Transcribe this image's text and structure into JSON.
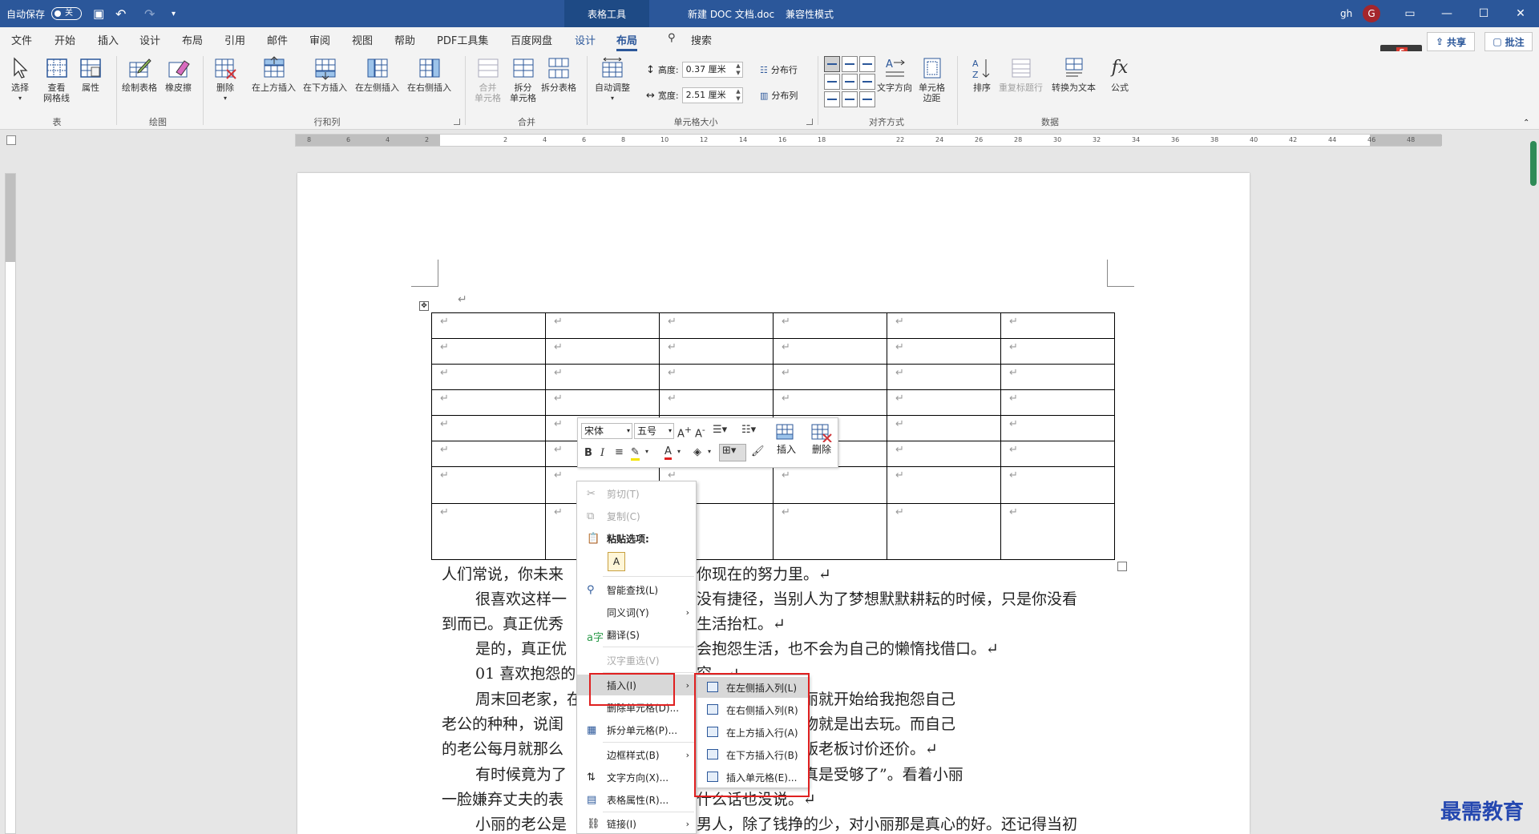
{
  "titlebar": {
    "autosave_label": "自动保存",
    "autosave_state": "关",
    "context_tab": "表格工具",
    "doc_title": "新建 DOC 文档.doc",
    "mode": "兼容性模式",
    "user_initials": "gh",
    "avatar_letter": "G"
  },
  "menu": {
    "tabs": [
      "文件",
      "开始",
      "插入",
      "设计",
      "布局",
      "引用",
      "邮件",
      "审阅",
      "视图",
      "帮助",
      "PDF工具集",
      "百度网盘",
      "设计",
      "布局"
    ],
    "search": "搜索",
    "share": "共享",
    "comment": "批注"
  },
  "ribbon": {
    "table_group": {
      "label": "表",
      "select": "选择",
      "gridlines_1": "查看",
      "gridlines_2": "网格线",
      "properties": "属性"
    },
    "draw_group": {
      "label": "绘图",
      "draw_table": "绘制表格",
      "eraser": "橡皮擦"
    },
    "rows_cols_group": {
      "label": "行和列",
      "delete": "删除",
      "insert_above": "在上方插入",
      "insert_below": "在下方插入",
      "insert_left": "在左侧插入",
      "insert_right": "在右侧插入"
    },
    "merge_group": {
      "label": "合并",
      "merge_1": "合并",
      "merge_2": "单元格",
      "split_1": "拆分",
      "split_2": "单元格",
      "split_table": "拆分表格"
    },
    "cell_size_group": {
      "label": "单元格大小",
      "autofit": "自动调整",
      "height_label": "高度:",
      "height_value": "0.37 厘米",
      "width_label": "宽度:",
      "width_value": "2.51 厘米",
      "distribute_rows": "分布行",
      "distribute_cols": "分布列"
    },
    "alignment_group": {
      "label": "对齐方式",
      "text_direction": "文字方向",
      "margins_1": "单元格",
      "margins_2": "边距"
    },
    "data_group": {
      "label": "数据",
      "sort": "排序",
      "repeat_header": "重复标题行",
      "convert": "转换为文本",
      "formula": "公式"
    }
  },
  "ruler": {
    "h_ticks": [
      "8",
      "6",
      "4",
      "2",
      "",
      "2",
      "4",
      "6",
      "8",
      "10",
      "12",
      "14",
      "16",
      "18",
      "",
      "22",
      "24",
      "26",
      "28",
      "30",
      "32",
      "34",
      "36",
      "38",
      "40",
      "42",
      "44",
      "46",
      "48"
    ]
  },
  "document": {
    "lines": [
      {
        "text_a": "人们常说，你未来",
        "text_b": "你现在的努力里。↵"
      },
      {
        "text_a": "很喜欢这样一",
        "text_b": "没有捷径，当别人为了梦想默默耕耘的时候，只是你没看"
      },
      {
        "text_a": "到而已。真正优秀",
        "text_b": "生活抬杠。↵"
      },
      {
        "text_a": "是的，真正优",
        "text_b": "会抱怨生活，也不会为自己的懒惰找借口。↵"
      },
      {
        "text_a": "01 喜欢抱怨的",
        "text_b": "穷。↵"
      },
      {
        "text_a": "周末回老家，在",
        "text_b": "没说两句话，小丽就开始给我抱怨自己"
      },
      {
        "text_a": "老公的种种，说闺",
        "text_b": "闺蜜每天除了购物就是出去玩。而自己"
      },
      {
        "text_a": "的老公每月就那么",
        "text_b": "的时候还总跟菜贩老板讨价还价。↵"
      },
      {
        "text_a": "有时候竟为了",
        "text_b": "道吗？阿心，我真是受够了”。看着小丽"
      },
      {
        "text_a": "一脸嫌弃丈夫的表",
        "text_b": "什么话也没说。↵"
      },
      {
        "text_a": "小丽的老公是",
        "text_b": "男人，除了钱挣的少，对小丽那是真心的好。还记得当初"
      }
    ],
    "cell_mark": "↵",
    "para_mark": "↵"
  },
  "minibar": {
    "font": "宋体",
    "size": "五号",
    "insert": "插入",
    "delete": "删除"
  },
  "context_menu": {
    "cut": "剪切(T)",
    "copy": "复制(C)",
    "paste_options": "粘贴选项:",
    "smart_lookup": "智能查找(L)",
    "synonyms": "同义词(Y)",
    "translate": "翻译(S)",
    "reconvert": "汉字重选(V)",
    "insert": "插入(I)",
    "delete_cells": "删除单元格(D)...",
    "split_cells": "拆分单元格(P)...",
    "border_styles": "边框样式(B)",
    "text_direction": "文字方向(X)...",
    "table_properties": "表格属性(R)...",
    "link": "链接(I)"
  },
  "submenu": {
    "insert_left": "在左侧插入列(L)",
    "insert_right": "在右侧插入列(R)",
    "insert_above": "在上方插入行(A)",
    "insert_below": "在下方插入行(B)",
    "insert_cells": "插入单元格(E)..."
  },
  "watermark": "最需教育",
  "colors": {
    "titlebar": "#2b579a",
    "highlight": "#e02020",
    "watermark": "#2548b0"
  }
}
